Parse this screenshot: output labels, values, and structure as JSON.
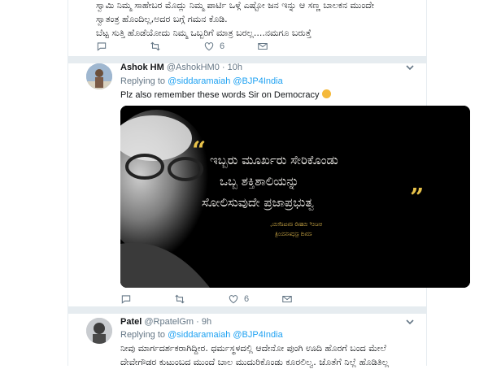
{
  "tweets": [
    {
      "text_lines": [
        "ಸ್ವಾಮಿ ನಿಮ್ಮ ಸಾಹೇಬರ ಮೊದ್ಲು ನಿಮ್ಮ ಪಾರ್ಟಿ ಒಳ್ಗೆ ಎಷ್ಟೋ ಜನ ಇನ್ನು ಆ ಸಣ್ಣ ಬಾಲಕನ ಮುಂದೇ",
        "ಸ್ವಾತಂತ್ರ ಹೊಂದಿಲ್ಲ,ಅದರ ಬಗ್ಗೆ ಗಮನ ಕೊಡಿ.",
        "ಬೆಟ್ಟ ಸುತ್ತಿ ಹೊಡೆಯೋದು ನಿಮ್ಮ ಒಬ್ಬರಿಗೆ ಮಾತ್ರ ಬರಲ್ಲ....ನಮಗೂ ಬರುತ್ತೆ"
      ],
      "actions": {
        "reply": "",
        "retweet": "",
        "like": "6"
      }
    },
    {
      "name": "Ashok HM",
      "handle": "@AshokHM0",
      "dot": "·",
      "time": "10h",
      "replying_label": "Replying to",
      "replying_to": [
        "@siddaramaiah",
        "@BJP4India"
      ],
      "text": "Plz also remember these words Sir on Democracy",
      "media": {
        "quote_lines": [
          "ಇಬ್ಬರು ಮೂರ್ಖರು ಸೇರಿಕೊಂಡು",
          "ಒಬ್ಬ ಶಕ್ತಿಶಾಲಿಯನ್ನು",
          "ಸೋಲಿಸುವುದೇ ಪ್ರಜಾಪ್ರಭುತ್ವ"
        ],
        "open_quote": "“",
        "close_quote": "”",
        "attribution": [
          "ಅಟಲ್ ಬಿಹಾರಿ ವಾಜಪೇಯಿ,",
          "ಮಾಜಿ ಪ್ರಧಾನಮಂತ್ರಿ"
        ]
      },
      "actions": {
        "reply": "",
        "retweet": "",
        "like": "6"
      }
    },
    {
      "name": "Patel",
      "handle": "@RpatelGm",
      "dot": "·",
      "time": "9h",
      "replying_label": "Replying to",
      "replying_to": [
        "@siddaramaiah",
        "@BJP4India"
      ],
      "text_lines": [
        "ನೀವು ಮಾರ್ಗದರ್ಶಕರಾಗಿದ್ದೀರ. ಧರ್ಮಸ್ಥಳದಲ್ಲಿ ಆದೇನೋ ಪುಂಗಿ ಊದಿ ಹೊರಗೆ ಬಂದ ಮೇಲೆ",
        "ದೇವೇಗೌಡರ ಕುಟುಂಬದ ಮುಂದೆ ಬಾಲ ಮುದುರಿಕೊಂಡು ಕೂರಲಿಲ್ವ. ಜೊತೆಗೆ ನಿಲ್ಲೆ ಹೊಡಿತಿಲ್ಲ"
      ]
    }
  ],
  "colors": {
    "link": "#1da1f2",
    "muted": "#657786",
    "divider": "#e6ecf0",
    "quote_accent": "#e8c24a"
  },
  "icons": {
    "reply": "reply-icon",
    "retweet": "retweet-icon",
    "like": "heart-icon",
    "message": "envelope-icon",
    "menu": "chevron-down-icon"
  }
}
